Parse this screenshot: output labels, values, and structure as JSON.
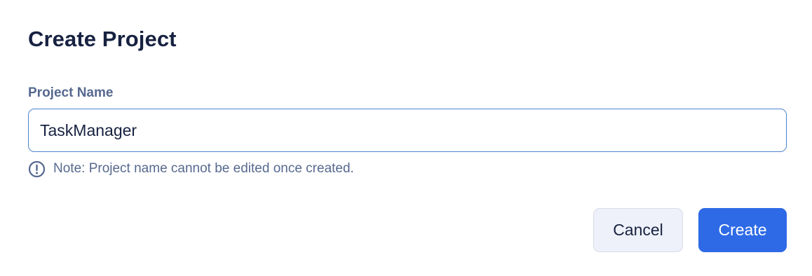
{
  "dialog": {
    "title": "Create Project",
    "field": {
      "label": "Project Name",
      "value": "TaskManager",
      "placeholder": ""
    },
    "note": {
      "icon": "exclamation-circle-icon",
      "text": "Note: Project name cannot be edited once created."
    },
    "actions": {
      "cancel_label": "Cancel",
      "create_label": "Create"
    }
  },
  "colors": {
    "title": "#172241",
    "label": "#56698f",
    "input_border": "#4d84cf",
    "primary": "#2e6ae6",
    "secondary_bg": "#eef1f9"
  }
}
